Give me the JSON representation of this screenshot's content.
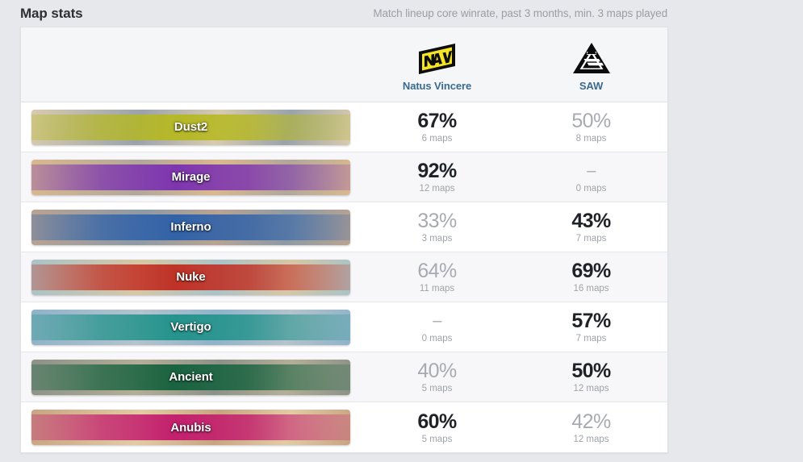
{
  "header": {
    "title": "Map stats",
    "subtitle": "Match lineup core winrate, past 3 months, min. 3 maps played"
  },
  "teams": [
    {
      "name": "Natus Vincere",
      "logo_icon": "navi-logo-icon"
    },
    {
      "name": "SAW",
      "logo_icon": "saw-logo-icon"
    }
  ],
  "colors": {
    "team_name": "#3b6a8f",
    "winner_pct": "#1f2226",
    "loser_pct": "#a7abb1",
    "maps_count": "#9fa3a9",
    "page_background": "#e6e8ec",
    "row_background": "#ffffff",
    "row_background_alt": "#f7f7f9",
    "header_background": "#f5f6f7"
  },
  "rows": [
    {
      "map": "Dust2",
      "tint": "#b5b820",
      "photo_a": "#d8cbae",
      "photo_b": "#9aa3ab",
      "team1": {
        "pct": "67%",
        "maps": "6 maps",
        "state": "win"
      },
      "team2": {
        "pct": "50%",
        "maps": "8 maps",
        "state": "lose"
      }
    },
    {
      "map": "Mirage",
      "tint": "#7a2fb0",
      "photo_a": "#d9b88f",
      "photo_b": "#b2a79b",
      "team1": {
        "pct": "92%",
        "maps": "12 maps",
        "state": "win"
      },
      "team2": {
        "pct": "–",
        "maps": "0 maps",
        "state": "none"
      }
    },
    {
      "map": "Inferno",
      "tint": "#2c5fa8",
      "photo_a": "#b9a392",
      "photo_b": "#8d9aa6",
      "team1": {
        "pct": "33%",
        "maps": "3 maps",
        "state": "lose"
      },
      "team2": {
        "pct": "43%",
        "maps": "7 maps",
        "state": "win"
      }
    },
    {
      "map": "Nuke",
      "tint": "#c02a1f",
      "photo_a": "#a9c3c8",
      "photo_b": "#d7c6a4",
      "team1": {
        "pct": "64%",
        "maps": "11 maps",
        "state": "lose"
      },
      "team2": {
        "pct": "69%",
        "maps": "16 maps",
        "state": "win"
      }
    },
    {
      "map": "Vertigo",
      "tint": "#1f9189",
      "photo_a": "#8fb3c9",
      "photo_b": "#b4c3cc",
      "team1": {
        "pct": "–",
        "maps": "0 maps",
        "state": "none"
      },
      "team2": {
        "pct": "57%",
        "maps": "7 maps",
        "state": "win"
      }
    },
    {
      "map": "Ancient",
      "tint": "#13603c",
      "photo_a": "#8c9287",
      "photo_b": "#b3ae97",
      "team1": {
        "pct": "40%",
        "maps": "5 maps",
        "state": "lose"
      },
      "team2": {
        "pct": "50%",
        "maps": "12 maps",
        "state": "win"
      }
    },
    {
      "map": "Anubis",
      "tint": "#c2186b",
      "photo_a": "#c8a483",
      "photo_b": "#e3cba6",
      "team1": {
        "pct": "60%",
        "maps": "5 maps",
        "state": "win"
      },
      "team2": {
        "pct": "42%",
        "maps": "12 maps",
        "state": "lose"
      }
    }
  ]
}
